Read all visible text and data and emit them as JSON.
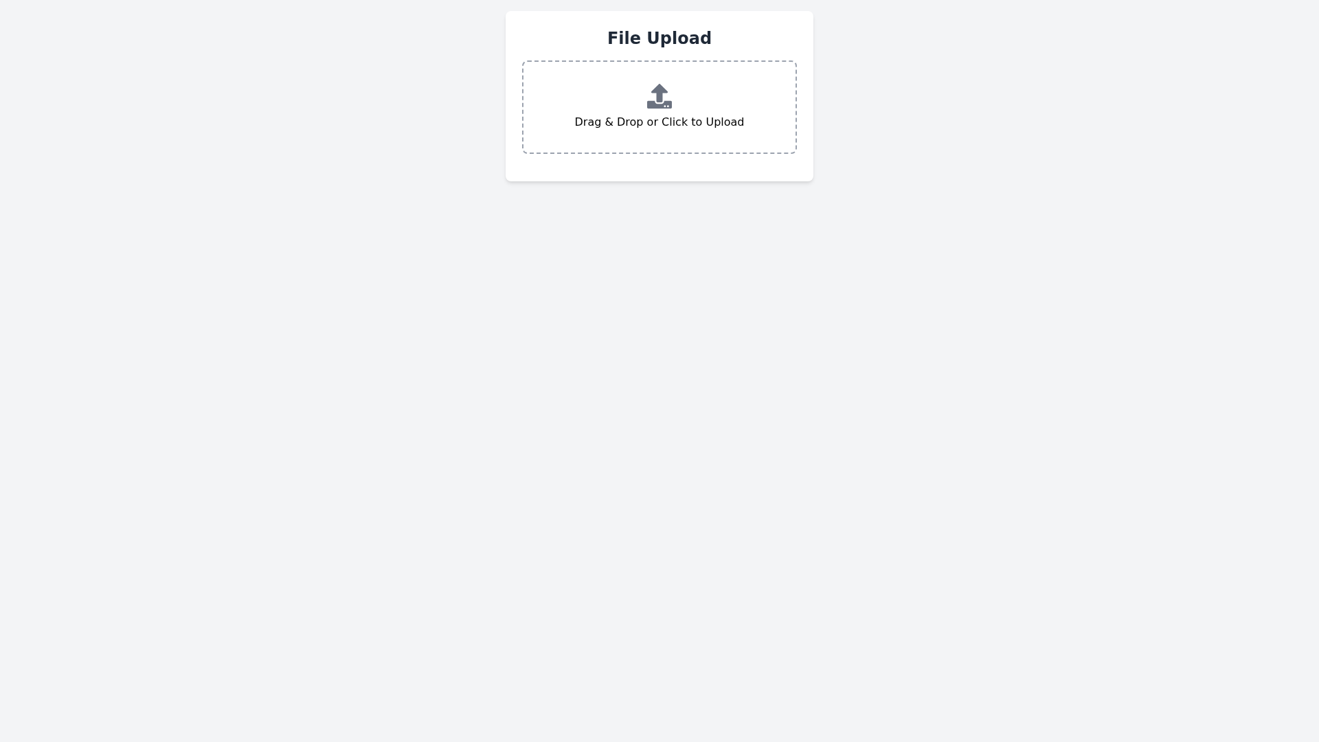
{
  "card": {
    "title": "File Upload",
    "dropzone": {
      "label": "Drag & Drop or Click to Upload"
    }
  }
}
